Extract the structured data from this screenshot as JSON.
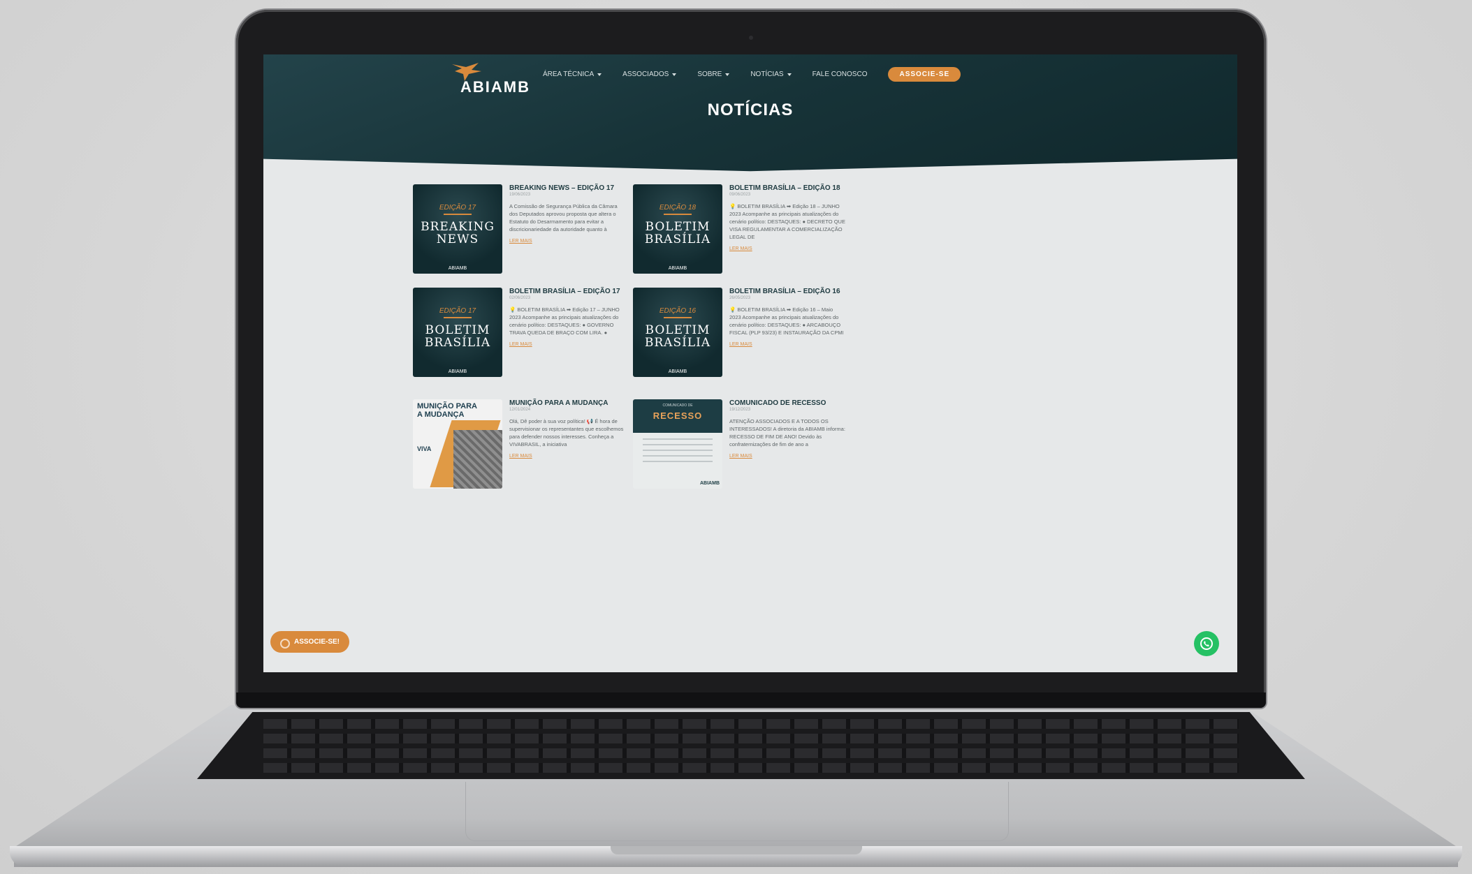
{
  "brand": {
    "name": "ABIAMB"
  },
  "nav": {
    "items": [
      {
        "label": "ÁREA TÉCNICA",
        "dropdown": true
      },
      {
        "label": "ASSOCIADOS",
        "dropdown": true
      },
      {
        "label": "SOBRE",
        "dropdown": true
      },
      {
        "label": "NOTÍCIAS",
        "dropdown": true
      },
      {
        "label": "FALE CONOSCO",
        "dropdown": false
      }
    ],
    "cta_label": "ASSOCIE-SE"
  },
  "page": {
    "title": "NOTÍCIAS"
  },
  "news": [
    {
      "title": "BREAKING NEWS – EDIÇÃO 17",
      "date": "19/06/2023",
      "excerpt": "A Comissão de Segurança Pública da Câmara dos Deputados aprovou proposta que altera o Estatuto do Desarmamento para evitar a discricionariedade da autoridade quanto à",
      "link": "LER MAIS",
      "thumb": {
        "edition": "EDIÇÃO 17",
        "line1": "BREAKING",
        "line2": "NEWS",
        "logo": "ABIAMB"
      }
    },
    {
      "title": "BOLETIM BRASÍLIA – EDIÇÃO 18",
      "date": "09/06/2023",
      "excerpt": "💡 BOLETIM BRASÍLIA ➡ Edição 18 – JUNHO 2023 Acompanhe as principais atualizações do cenário político: DESTAQUES: ● DECRETO QUE VISA REGULAMENTAR A COMERCIALIZAÇÃO LEGAL DE",
      "link": "LER MAIS",
      "thumb": {
        "edition": "EDIÇÃO 18",
        "line1": "BOLETIM",
        "line2": "BRASÍLIA",
        "logo": "ABIAMB"
      }
    },
    {
      "title": "BOLETIM BRASÍLIA – EDIÇÃO 17",
      "date": "02/06/2023",
      "excerpt": "💡 BOLETIM BRASÍLIA ➡ Edição 17 – JUNHO 2023 Acompanhe as principais atualizações do cenário político: DESTAQUES: ● GOVERNO TRAVA QUEDA DE BRAÇO COM LIRA. ●",
      "link": "LER MAIS",
      "thumb": {
        "edition": "EDIÇÃO 17",
        "line1": "BOLETIM",
        "line2": "BRASÍLIA",
        "logo": "ABIAMB"
      }
    },
    {
      "title": "BOLETIM BRASÍLIA – EDIÇÃO 16",
      "date": "26/05/2023",
      "excerpt": "💡 BOLETIM BRASÍLIA ➡ Edição 16 – Maio 2023 Acompanhe as principais atualizações do cenário político: DESTAQUES: ● ARCABOUÇO FISCAL (PLP 93/23) E INSTAURAÇÃO DA CPMI",
      "link": "LER MAIS",
      "thumb": {
        "edition": "EDIÇÃO 16",
        "line1": "BOLETIM",
        "line2": "BRASÍLIA",
        "logo": "ABIAMB"
      }
    },
    {
      "title": "MUNIÇÃO PARA A MUDANÇA",
      "date": "12/01/2024",
      "excerpt": "Olá, Dê poder à sua voz política! 📢 É hora de supervisionar os representantes que escolhemos para defender nossos interesses. Conheça a VIVABRASIL, a iniciativa",
      "link": "LER MAIS",
      "thumb": {
        "line1": "MUNIÇÃO PARA",
        "line2": "A MUDANÇA",
        "mark": "VIVA"
      }
    },
    {
      "title": "COMUNICADO DE RECESSO",
      "date": "19/12/2023",
      "excerpt": "ATENÇÃO ASSOCIADOS E A TODOS OS INTERESSADOS! A diretoria da ABIAMB informa: RECESSO DE FIM DE ANO! Devido às confraternizações de fim de ano a",
      "link": "LER MAIS",
      "thumb": {
        "small": "COMUNICADO DE",
        "line1": "RECESSO",
        "logo": "ABIAMB"
      }
    }
  ],
  "floating": {
    "cta_label": "ASSOCIE-SE!",
    "whatsapp": "whatsapp-icon"
  },
  "colors": {
    "accent": "#d98a3c",
    "header_bg": "#173338",
    "title_text": "#1e3a40"
  }
}
